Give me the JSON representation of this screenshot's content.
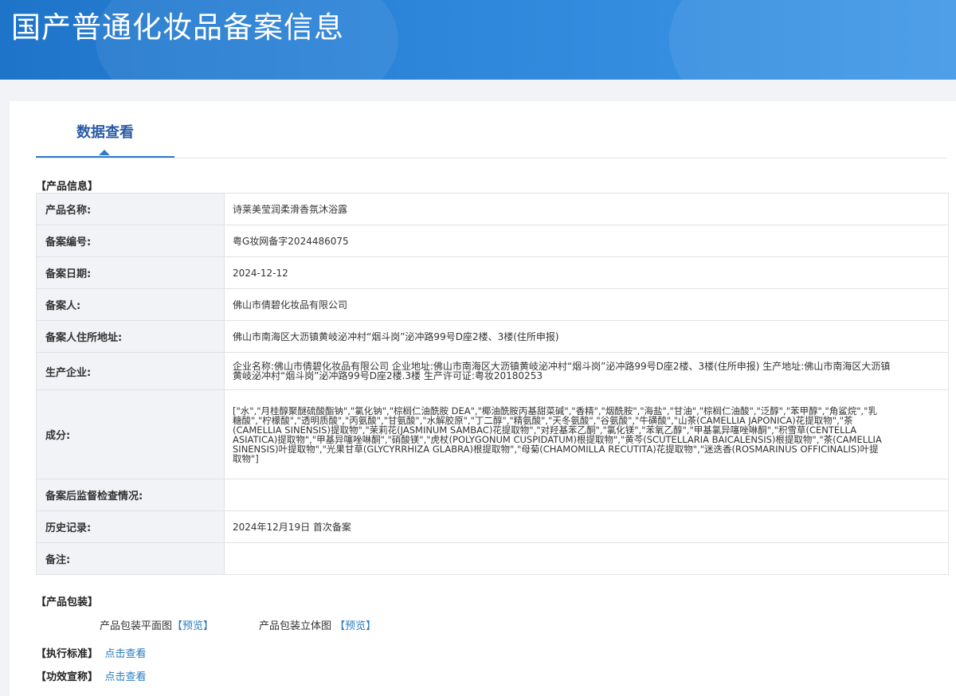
{
  "header": {
    "title": "国产普通化妆品备案信息"
  },
  "tabs": [
    {
      "label": "数据查看"
    }
  ],
  "sections": {
    "product_info": "【产品信息】",
    "packaging": "【产品包装】",
    "standard": "【执行标准】",
    "efficacy": "【功效宣称】"
  },
  "product": {
    "name": {
      "label": "产品名称:",
      "value": "诗莱美莹润柔滑香氛沐浴露"
    },
    "reg_no": {
      "label": "备案编号:",
      "value": "粤G妆网备字2024486075"
    },
    "reg_date": {
      "label": "备案日期:",
      "value": "2024-12-12"
    },
    "registrant": {
      "label": "备案人:",
      "value": "佛山市倩碧化妆品有限公司"
    },
    "address": {
      "label": "备案人住所地址:",
      "value": "佛山市南海区大沥镇黄岐泌冲村“烟斗岗”泌冲路99号D座2楼、3楼(住所申报)"
    },
    "manufacturer": {
      "label": "生产企业:",
      "value": "企业名称:佛山市倩碧化妆品有限公司 企业地址:佛山市南海区大沥镇黄岐泌冲村“烟斗岗”泌冲路99号D座2楼、3楼(住所申报) 生产地址:佛山市南海区大沥镇黄岐泌冲村“烟斗岗”泌冲路99号D座2楼.3楼 生产许可证:粤妆20180253"
    },
    "ingredients": {
      "label": "成分:",
      "value": "[\"水\",\"月桂醇聚醚硫酸酯钠\",\"氯化钠\",\"棕榈仁油酰胺 DEA\",\"椰油酰胺丙基甜菜碱\",\"香精\",\"烟酰胺\",\"海盐\",\"甘油\",\"棕榈仁油酸\",\"泛醇\",\"苯甲醇\",\"角鲨烷\",\"乳糖酸\",\"柠檬酸\",\"透明质酸\",\"丙氨酸\",\"甘氨酸\",\"水解胶原\",\"丁二醇\",\"精氨酸\",\"天冬氨酸\",\"谷氨酸\",\"牛磺酸\",\"山茶(CAMELLIA JAPONICA)花提取物\",\"茶(CAMELLIA SINENSIS)提取物\",\"茉莉花(JASMINUM SAMBAC)花提取物\",\"对羟基苯乙酮\",\"氯化镁\",\"苯氧乙醇\",\"甲基氯异噻唑啉酮\",\"积雪草(CENTELLA ASIATICA)提取物\",\"甲基异噻唑啉酮\",\"硝酸镁\",\"虎杖(POLYGONUM CUSPIDATUM)根提取物\",\"黄芩(SCUTELLARIA BAICALENSIS)根提取物\",\"茶(CAMELLIA SINENSIS)叶提取物\",\"光果甘草(GLYCYRRHIZA GLABRA)根提取物\",\"母菊(CHAMOMILLA RECUTITA)花提取物\",\"迷迭香(ROSMARINUS OFFICINALIS)叶提取物\"]"
    },
    "supervision": {
      "label": "备案后监督检查情况:",
      "value": ""
    },
    "history": {
      "label": "历史记录:",
      "value": "2024年12月19日 首次备案"
    },
    "remarks": {
      "label": "备注:",
      "value": ""
    }
  },
  "packaging": {
    "flat_label": "产品包装平面图",
    "flat_link": "【预览】",
    "solid_label": "产品包装立体图",
    "solid_link": "【预览】"
  },
  "links": {
    "standard": "点击查看",
    "efficacy": "点击查看"
  }
}
